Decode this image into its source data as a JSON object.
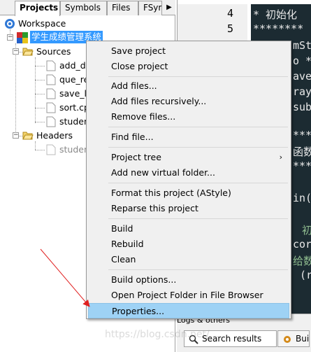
{
  "left_panel": {
    "tabs": [
      "Projects",
      "Symbols",
      "Files",
      "FSym"
    ],
    "active_tab": "Projects",
    "tree": {
      "workspace": "Workspace",
      "project": "学生成绩管理系统",
      "sources_folder": "Sources",
      "sources_files": [
        "add_di",
        "que_re",
        "save_lo",
        "sort.cp",
        "studen"
      ],
      "headers_folder": "Headers",
      "headers_files": [
        "studen"
      ]
    }
  },
  "editor": {
    "line_numbers": [
      "4",
      "5"
    ],
    "code_lines": [
      "* 初始化",
      "********",
      "mSt",
      "o *",
      "ave",
      "ray",
      "sub",
      "****",
      "函数",
      "****",
      "in(",
      "初",
      "cor",
      "给数",
      "(r"
    ]
  },
  "context_menu": {
    "items": [
      {
        "label": "Save project"
      },
      {
        "label": "Close project"
      },
      {
        "label": "Add files..."
      },
      {
        "label": "Add files recursively..."
      },
      {
        "label": "Remove files..."
      },
      {
        "label": "Find file..."
      },
      {
        "label": "Project tree",
        "submenu": true
      },
      {
        "label": "Add new virtual folder..."
      },
      {
        "label": "Format this project (AStyle)"
      },
      {
        "label": "Reparse this project"
      },
      {
        "label": "Build"
      },
      {
        "label": "Rebuild"
      },
      {
        "label": "Clean"
      },
      {
        "label": "Build options..."
      },
      {
        "label": "Open Project Folder in File Browser"
      },
      {
        "label": "Properties...",
        "highlighted": true
      }
    ]
  },
  "bottom_panel": {
    "title": "Logs & others",
    "tabs": [
      "Search results",
      "Bui"
    ]
  },
  "watermark": "https://blog.csdn.net/..."
}
